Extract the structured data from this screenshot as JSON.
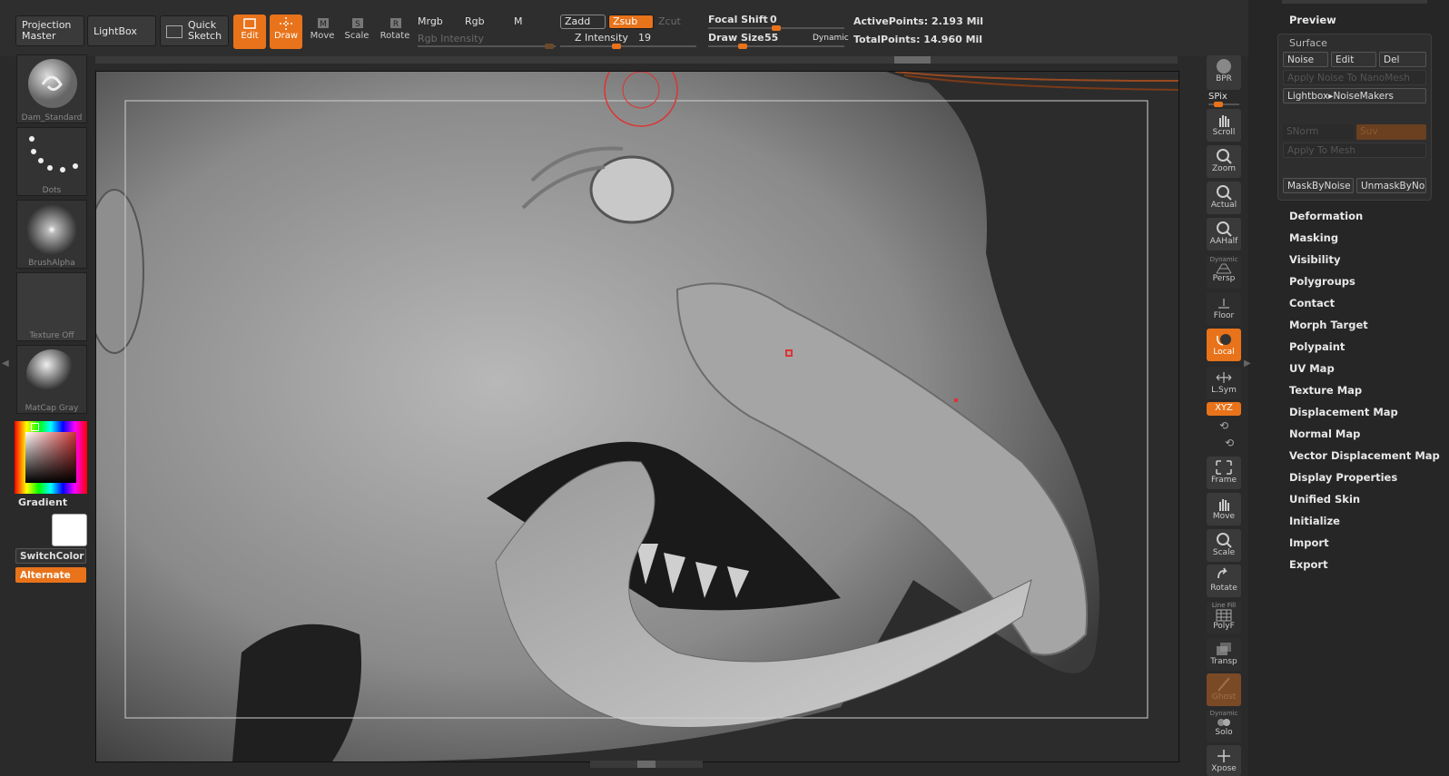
{
  "toolbar": {
    "projection_master": "Projection Master",
    "lightbox": "LightBox",
    "quick_sketch": "Quick Sketch",
    "edit": "Edit",
    "draw": "Draw",
    "move": "Move",
    "scale": "Scale",
    "rotate": "Rotate",
    "mrgb": "Mrgb",
    "rgb": "Rgb",
    "m": "M",
    "zadd": "Zadd",
    "zsub": "Zsub",
    "zcut": "Zcut",
    "rgb_intensity": "Rgb Intensity",
    "z_intensity_label": "Z Intensity",
    "z_intensity_value": "19",
    "z_intensity_level": 0.19,
    "focal_shift_label": "Focal Shift",
    "focal_shift_value": "0",
    "draw_size_label": "Draw Size",
    "draw_size_value": "55",
    "dynamic": "Dynamic",
    "active_points": "ActivePoints: 2.193 Mil",
    "total_points": "TotalPoints: 14.960 Mil"
  },
  "left_shelf": {
    "brush": "Dam_Standard",
    "stroke": "Dots",
    "alpha": "BrushAlpha",
    "texture": "Texture Off",
    "material": "MatCap Gray",
    "gradient": "Gradient",
    "switch_color": "SwitchColor",
    "alternate": "Alternate"
  },
  "right_shelf": {
    "bpr": "BPR",
    "spix": "SPix",
    "scroll": "Scroll",
    "zoom": "Zoom",
    "actual": "Actual",
    "aahalf": "AAHalf",
    "persp": "Persp",
    "floor": "Floor",
    "local": "Local",
    "lsym": "L.Sym",
    "xyz": "XYZ",
    "frame": "Frame",
    "move": "Move",
    "scale": "Scale",
    "rotate": "Rotate",
    "polyf": "PolyF",
    "transp": "Transp",
    "ghost": "Ghost",
    "solo": "Solo",
    "xpose": "Xpose",
    "dynamic": "Dynamic",
    "line_fill": "Line Fill"
  },
  "palette": {
    "preview": "Preview",
    "surface": "Surface",
    "noise": "Noise",
    "edit": "Edit",
    "del": "Del",
    "apply_noise_nanomesh": "Apply Noise To NanoMesh",
    "lightbox_noisemakers": "Lightbox▸NoiseMakers",
    "snorm": "SNorm",
    "suv": "Suv",
    "apply_to_mesh": "Apply To Mesh",
    "mask_by_noise": "MaskByNoise",
    "unmask_by_noise": "UnmaskByNo",
    "items": [
      "Deformation",
      "Masking",
      "Visibility",
      "Polygroups",
      "Contact",
      "Morph Target",
      "Polypaint",
      "UV Map",
      "Texture Map",
      "Displacement Map",
      "Normal Map",
      "Vector Displacement Map",
      "Display Properties",
      "Unified Skin",
      "Initialize",
      "Import",
      "Export"
    ]
  },
  "colors": {
    "accent": "#e8731a",
    "bg": "#2a2a2a"
  }
}
